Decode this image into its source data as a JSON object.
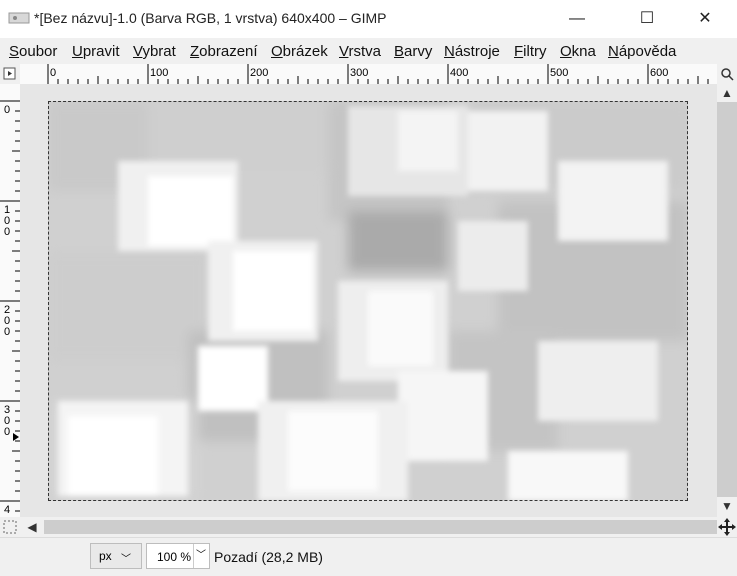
{
  "window": {
    "title": "*[Bez názvu]-1.0 (Barva RGB, 1 vrstva) 640x400 – GIMP",
    "minimize_glyph": "—",
    "maximize_glyph": "☐",
    "close_glyph": "✕"
  },
  "menu": [
    {
      "mn": "S",
      "rest": "oubor"
    },
    {
      "mn": "U",
      "rest": "pravit"
    },
    {
      "mn": "V",
      "rest": "ybrat"
    },
    {
      "mn": "Z",
      "rest": "obrazení"
    },
    {
      "mn": "O",
      "rest": "brázek"
    },
    {
      "mn": "V",
      "rest": "rstva"
    },
    {
      "mn": "B",
      "rest": "arvy"
    },
    {
      "mn": "N",
      "rest": "ástroje"
    },
    {
      "mn": "F",
      "rest": "iltry"
    },
    {
      "mn": "O",
      "rest": "kna"
    },
    {
      "mn": "N",
      "rest": "ápověda"
    }
  ],
  "rulers": {
    "horizontal_labels": [
      "0",
      "100",
      "200",
      "300",
      "400",
      "500",
      "600"
    ],
    "vertical_labels": [
      "0",
      "100",
      "200",
      "300",
      "4"
    ]
  },
  "status": {
    "unit": "px",
    "zoom": "100 %",
    "layer_info": "Pozadí (28,2 MB)"
  },
  "icons": {
    "app": "gimp-app-icon",
    "quick_mask": "quick-mask-icon",
    "navigate": "navigate-icon",
    "menu_toggle": "image-menu-icon",
    "zoom_shrink": "shrink-wrap-icon",
    "nav_move": "move-navigation-icon"
  }
}
